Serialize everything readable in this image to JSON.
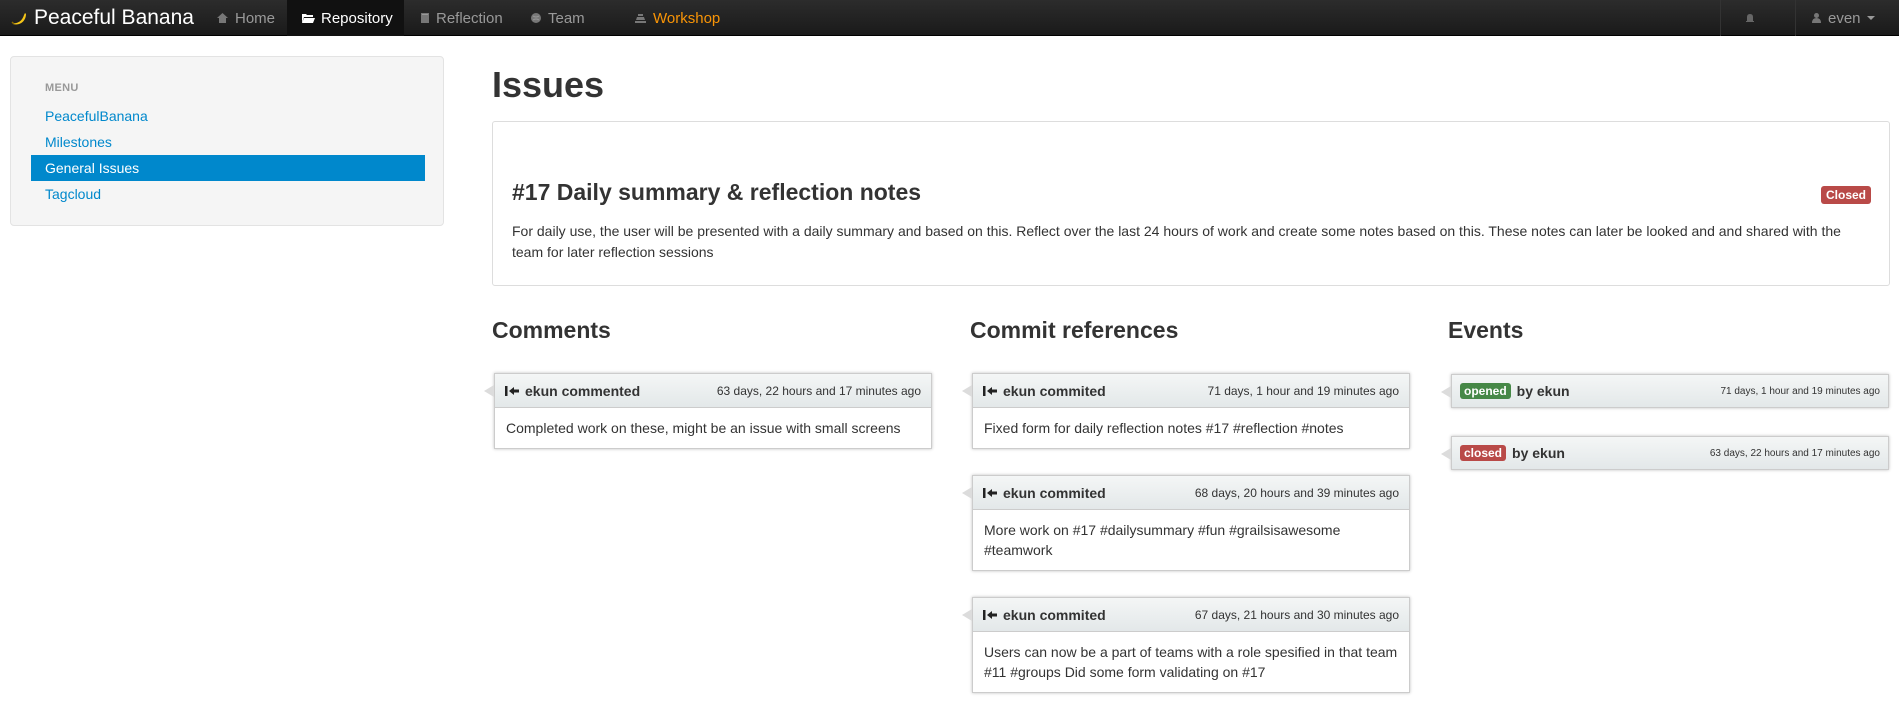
{
  "navbar": {
    "brand": "Peaceful Banana",
    "items": [
      {
        "label": "Home",
        "icon": "home-icon"
      },
      {
        "label": "Repository",
        "icon": "folder-open-icon"
      },
      {
        "label": "Reflection",
        "icon": "book-icon"
      },
      {
        "label": "Team",
        "icon": "globe-icon"
      },
      {
        "label": "Workshop",
        "icon": "workshop-icon"
      }
    ],
    "user": "even"
  },
  "sidebar": {
    "header": "MENU",
    "items": [
      {
        "label": "PeacefulBanana"
      },
      {
        "label": "Milestones"
      },
      {
        "label": "General Issues"
      },
      {
        "label": "Tagcloud"
      }
    ]
  },
  "page": {
    "title": "Issues"
  },
  "issue": {
    "title": "#17 Daily summary & reflection notes",
    "status": "Closed",
    "description": "For daily use, the user will be presented with a daily summary and based on this. Reflect over the last 24 hours of work and create some notes based on this. These notes can later be looked and and shared with the team for later reflection sessions"
  },
  "comments": {
    "title": "Comments",
    "items": [
      {
        "user": "ekun commented",
        "time": "63 days, 22 hours and 17 minutes ago",
        "body": "Completed work on these, might be an issue with small screens"
      }
    ]
  },
  "commits": {
    "title": "Commit references",
    "items": [
      {
        "user": "ekun commited",
        "time": "71 days, 1 hour and 19 minutes ago",
        "body": "Fixed form for daily reflection notes #17 #reflection #notes"
      },
      {
        "user": "ekun commited",
        "time": "68 days, 20 hours and 39 minutes ago",
        "body": "More work on #17 #dailysummary #fun #grailsisawesome #teamwork"
      },
      {
        "user": "ekun commited",
        "time": "67 days, 21 hours and 30 minutes ago",
        "body": "Users can now be a part of teams with a role spesified in that team #11 #groups Did some form validating on #17"
      }
    ]
  },
  "events": {
    "title": "Events",
    "items": [
      {
        "label": "opened",
        "by": "by ekun",
        "time": "71 days, 1 hour and 19 minutes ago"
      },
      {
        "label": "closed",
        "by": "by ekun",
        "time": "63 days, 22 hours and 17 minutes ago"
      }
    ]
  },
  "colors": {
    "link": "#0088cc",
    "active_menu_bg": "#0088cc",
    "closed_label": "#b94a48",
    "opened_label": "#468847",
    "workshop_nav": "#f89406",
    "navbar_bg": "#222222"
  }
}
